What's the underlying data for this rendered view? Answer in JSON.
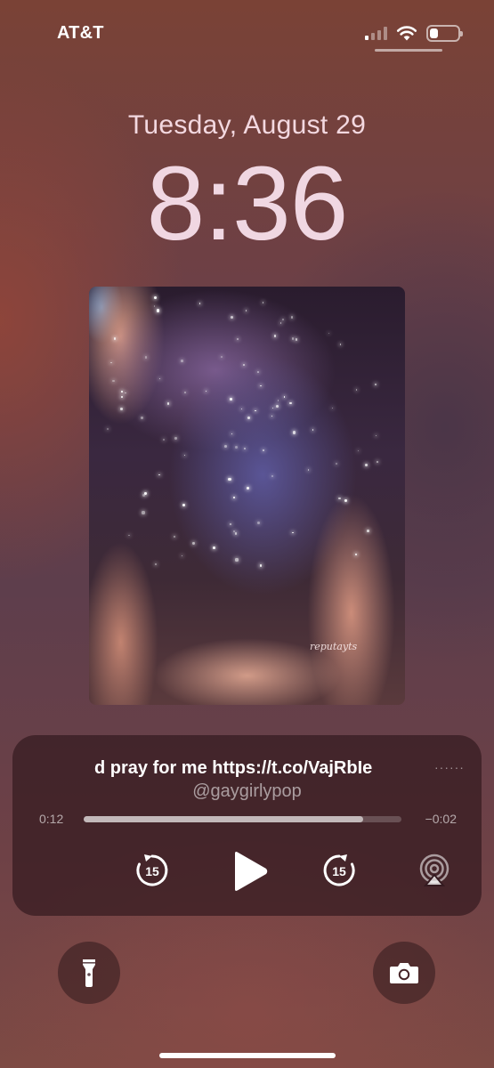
{
  "status_bar": {
    "carrier": "AT&T",
    "signal_icon": "cellular-signal-icon",
    "signal_bars_active": 1,
    "signal_bars_total": 4,
    "wifi_icon": "wifi-icon",
    "battery_icon": "battery-icon",
    "battery_level": 0.3
  },
  "lock_screen": {
    "date": "Tuesday, August 29",
    "time": "8:36"
  },
  "artwork": {
    "caption": "reputayts"
  },
  "now_playing": {
    "title": "d pray for me https://t.co/VajRbIe",
    "artist": "@gaygirlypop",
    "elapsed": "0:12",
    "remaining": "−0:02",
    "progress": 0.88,
    "skip_back_label": "15",
    "skip_forward_label": "15",
    "play_icon": "play-icon",
    "airplay_icon": "airplay-icon"
  },
  "quick_actions": {
    "flashlight_icon": "flashlight-icon",
    "camera_icon": "camera-icon"
  },
  "colors": {
    "time_tint": "#f0d7e2",
    "player_background": "#341a20"
  }
}
